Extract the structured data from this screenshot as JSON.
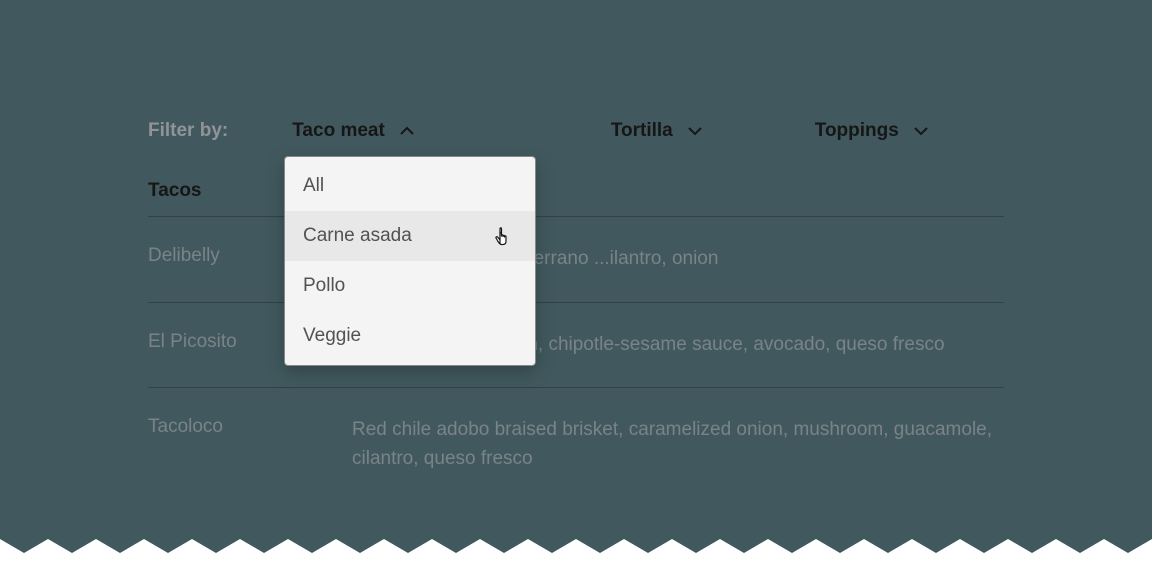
{
  "filters": {
    "label": "Filter by:",
    "items": [
      {
        "label": "Taco meat",
        "open": true
      },
      {
        "label": "Tortilla",
        "open": false
      },
      {
        "label": "Toppings",
        "open": false
      }
    ]
  },
  "dropdown": {
    "options": [
      {
        "label": "All",
        "highlighted": false
      },
      {
        "label": "Carne asada",
        "highlighted": true
      },
      {
        "label": "Pollo",
        "highlighted": false
      },
      {
        "label": "Veggie",
        "highlighted": false
      }
    ]
  },
  "section_title": "Tacos",
  "rows": [
    {
      "name": "Delibelly",
      "desc": "...w Honey tomatillo-serrano ...ilantro, onion"
    },
    {
      "name": "El Picosito",
      "desc": "Grilled beef tenderloin, chipotle-sesame sauce, avocado, queso fresco"
    },
    {
      "name": "Tacoloco",
      "desc": "Red chile adobo braised brisket, caramelized onion, mushroom, guacamole, cilantro, queso fresco"
    }
  ]
}
